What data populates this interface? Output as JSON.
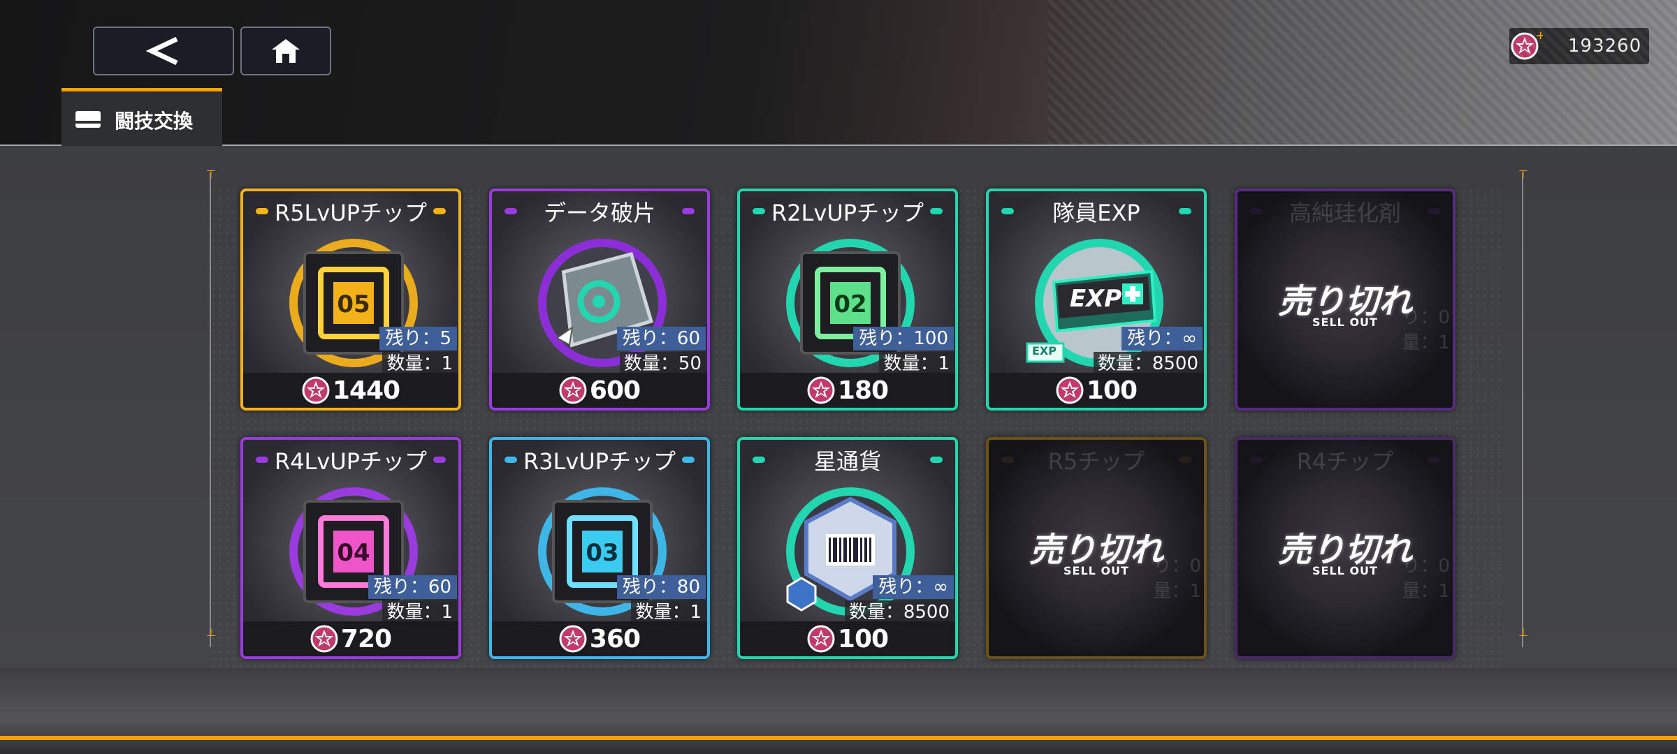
{
  "header": {
    "back_icon": "back-chevron-icon",
    "home_icon": "home-icon",
    "currency_icon": "star-medal-icon",
    "currency_amount": "193260"
  },
  "tab": {
    "label": "闘技交換",
    "icon": "card-icon"
  },
  "colors": {
    "gold": "#f3b21a",
    "purple": "#9a3be0",
    "teal": "#22d6b0",
    "blue": "#3eb6e8",
    "accent_orange": "#f3a10a"
  },
  "items": [
    {
      "title": "R5LvUPチップ",
      "remain": "残り：5",
      "qty": "数量：1",
      "price": "1440",
      "icon": "chip-05-icon"
    },
    {
      "title": "データ破片",
      "remain": "残り：60",
      "qty": "数量：50",
      "price": "600",
      "icon": "data-fragment-icon"
    },
    {
      "title": "R2LvUPチップ",
      "remain": "残り：100",
      "qty": "数量：1",
      "price": "180",
      "icon": "chip-02-icon"
    },
    {
      "title": "隊員EXP",
      "remain": "残り：∞",
      "qty": "数量：8500",
      "price": "100",
      "icon": "exp-ticket-icon",
      "badge": "EXP"
    },
    {
      "title": "高純珪化剤",
      "sold_main": "売り切れ",
      "sold_sub": "SELL OUT",
      "ghost_remain": "り：0",
      "ghost_qty": "量：1",
      "icon": "sold-out-icon"
    },
    {
      "title": "R4LvUPチップ",
      "remain": "残り：60",
      "qty": "数量：1",
      "price": "720",
      "icon": "chip-04-icon"
    },
    {
      "title": "R3LvUPチップ",
      "remain": "残り：80",
      "qty": "数量：1",
      "price": "360",
      "icon": "chip-03-icon"
    },
    {
      "title": "星通貨",
      "remain": "残り：∞",
      "qty": "数量：8500",
      "price": "100",
      "icon": "star-currency-icon"
    },
    {
      "title": "R5チップ",
      "sold_main": "売り切れ",
      "sold_sub": "SELL OUT",
      "ghost_remain": "り：0",
      "ghost_qty": "量：1",
      "icon": "sold-out-icon"
    },
    {
      "title": "R4チップ",
      "sold_main": "売り切れ",
      "sold_sub": "SELL OUT",
      "ghost_remain": "り：0",
      "ghost_qty": "量：1",
      "icon": "sold-out-icon"
    }
  ]
}
